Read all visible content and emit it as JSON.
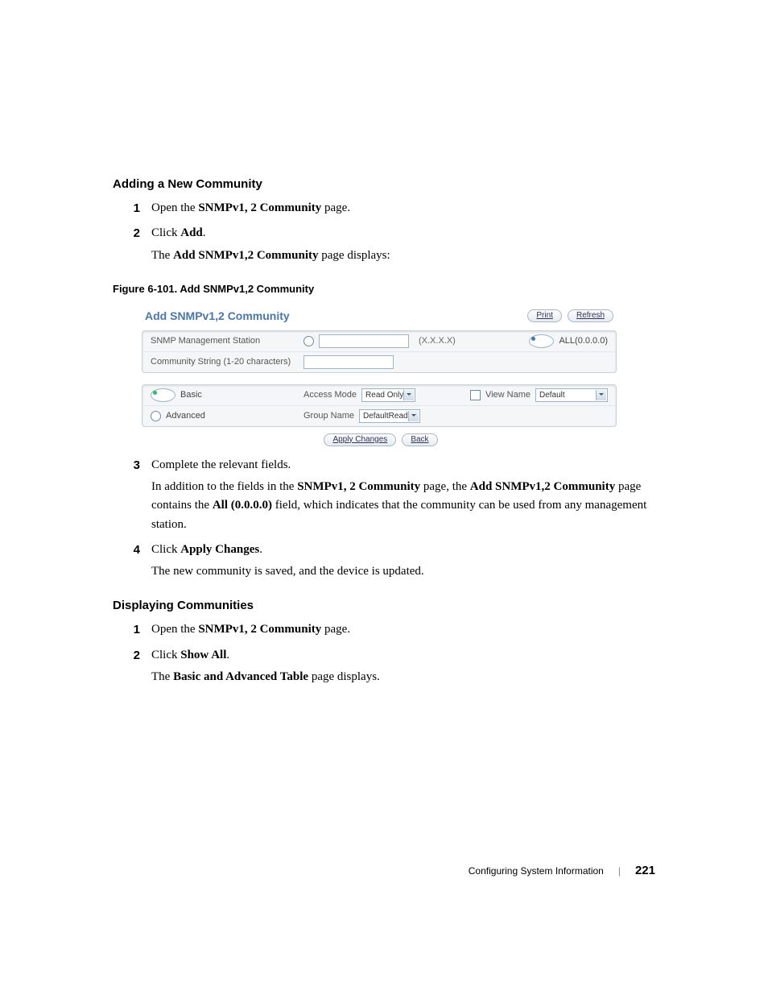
{
  "section1": {
    "heading": "Adding a New Community",
    "steps": [
      {
        "num": "1",
        "paras": [
          {
            "pre": "Open the ",
            "bold": "SNMPv1, 2 Community",
            "post": " page."
          }
        ]
      },
      {
        "num": "2",
        "paras": [
          {
            "pre": "Click ",
            "bold": "Add",
            "post": "."
          },
          {
            "pre": "The ",
            "bold": "Add SNMPv1,2 Community",
            "post": " page displays:"
          }
        ]
      }
    ]
  },
  "figure": {
    "caption": "Figure 6-101.    Add SNMPv1,2 Community"
  },
  "shot": {
    "title": "Add SNMPv1,2 Community",
    "print": "Print",
    "refresh": "Refresh",
    "row1_label": "SNMP Management Station",
    "row1_hint": "(X.X.X.X)",
    "row1_all": "ALL(0.0.0.0)",
    "row2_label": "Community String (1-20 characters)",
    "basic": "Basic",
    "advanced": "Advanced",
    "access_mode_label": "Access Mode",
    "access_mode_value": "Read Only",
    "view_name_label": "View Name",
    "view_name_value": "Default",
    "group_name_label": "Group Name",
    "group_name_value": "DefaultRead",
    "apply": "Apply Changes",
    "back": "Back"
  },
  "section2": {
    "steps": [
      {
        "num": "3",
        "paras": [
          {
            "pre": "Complete the relevant fields."
          },
          {
            "pre": "In addition to the fields in the ",
            "bold": "SNMPv1, 2 Community",
            "post": " page, the ",
            "bold2": "Add SNMPv1,2 Community",
            "post2": " page contains the ",
            "bold3": "All (0.0.0.0)",
            "post3": " field, which indicates that the community can be used from any management station."
          }
        ]
      },
      {
        "num": "4",
        "paras": [
          {
            "pre": "Click ",
            "bold": "Apply Changes",
            "post": "."
          },
          {
            "pre": "The new community is saved, and the device is updated."
          }
        ]
      }
    ]
  },
  "section3": {
    "heading": "Displaying Communities",
    "steps": [
      {
        "num": "1",
        "paras": [
          {
            "pre": "Open the ",
            "bold": "SNMPv1, 2 Community",
            "post": " page."
          }
        ]
      },
      {
        "num": "2",
        "paras": [
          {
            "pre": "Click ",
            "bold": "Show All",
            "post": "."
          },
          {
            "pre": "The ",
            "bold": "Basic and Advanced Table",
            "post": " page displays."
          }
        ]
      }
    ]
  },
  "footer": {
    "chapter": "Configuring System Information",
    "page": "221"
  }
}
